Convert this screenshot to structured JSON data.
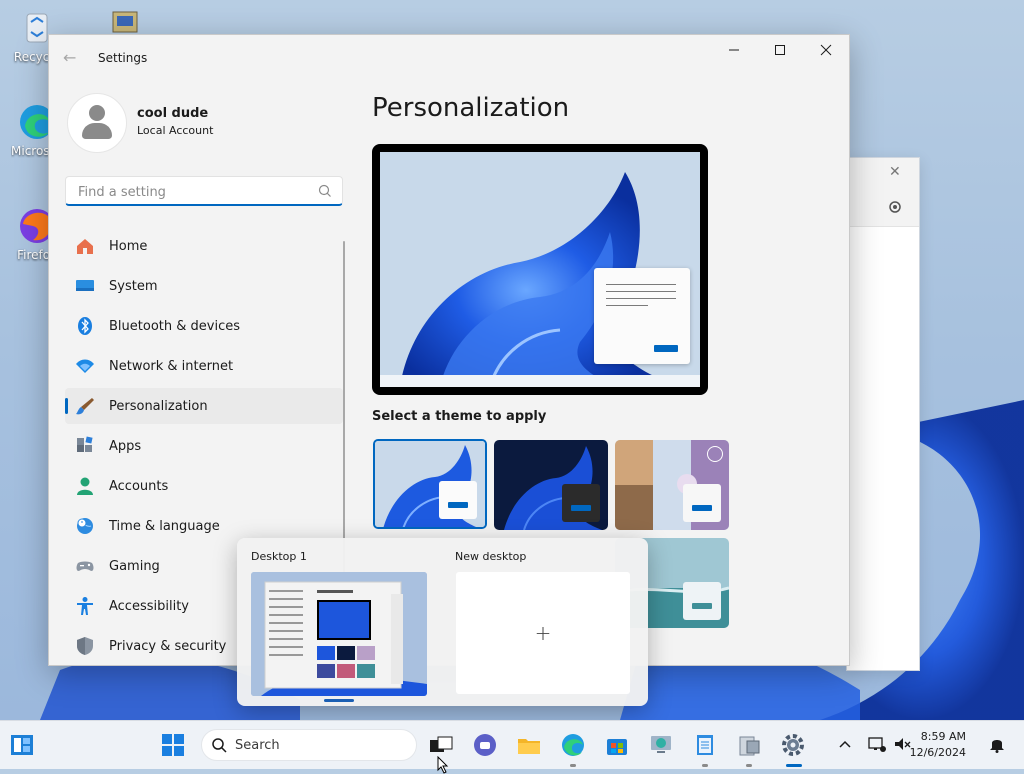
{
  "desktop": {
    "icons": [
      {
        "label": "Recycle",
        "name": "recycle-bin"
      },
      {
        "label": "Microsoft Edge",
        "name": "edge"
      },
      {
        "label": "Firefox",
        "name": "firefox"
      }
    ]
  },
  "settings": {
    "title": "Settings",
    "user": {
      "name": "cool dude",
      "account_type": "Local Account"
    },
    "search_placeholder": "Find a setting",
    "nav": [
      {
        "label": "Home",
        "icon": "home-icon"
      },
      {
        "label": "System",
        "icon": "system-icon"
      },
      {
        "label": "Bluetooth & devices",
        "icon": "bluetooth-icon"
      },
      {
        "label": "Network & internet",
        "icon": "wifi-icon"
      },
      {
        "label": "Personalization",
        "icon": "brush-icon",
        "active": true
      },
      {
        "label": "Apps",
        "icon": "apps-icon"
      },
      {
        "label": "Accounts",
        "icon": "accounts-icon"
      },
      {
        "label": "Time & language",
        "icon": "globe-clock-icon"
      },
      {
        "label": "Gaming",
        "icon": "gamepad-icon"
      },
      {
        "label": "Accessibility",
        "icon": "accessibility-icon"
      },
      {
        "label": "Privacy & security",
        "icon": "shield-icon"
      }
    ],
    "page_title": "Personalization",
    "theme_section_label": "Select a theme to apply",
    "themes": [
      {
        "name": "windows-light",
        "selected": true
      },
      {
        "name": "windows-dark"
      },
      {
        "name": "glow"
      },
      {
        "name": "flow"
      }
    ]
  },
  "task_view": {
    "desktops": [
      {
        "label": "Desktop 1",
        "current": true
      },
      {
        "label": "New desktop",
        "add_symbol": "+"
      }
    ]
  },
  "taskbar": {
    "search_label": "Search",
    "apps": [
      "start",
      "search",
      "task-view",
      "teams-chat",
      "file-explorer",
      "edge",
      "store",
      "remote-desktop",
      "notepad",
      "explorer-pane",
      "settings"
    ],
    "clock": {
      "time": "8:59 AM",
      "date": "12/6/2024"
    }
  },
  "colors": {
    "accent": "#0067c0",
    "bloom": "#1a5fe0"
  }
}
